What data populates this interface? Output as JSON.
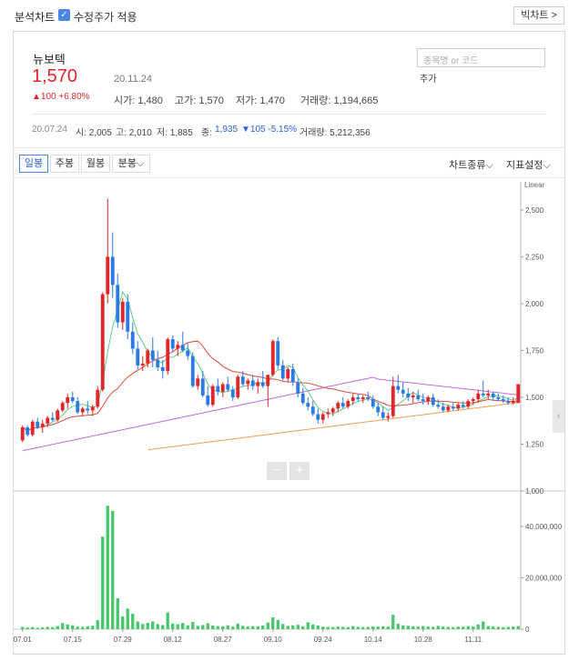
{
  "header": {
    "title": "분석차트",
    "adjust_label": "수정주가 적용",
    "big_chart_label": "빅차트 >"
  },
  "stock": {
    "name": "뉴보텍",
    "price": "1,570",
    "date": "20.11.24",
    "change": "▲100 +6.80%",
    "open": "시가: 1,480",
    "high": "고가: 1,570",
    "low": "저가: 1,470",
    "volume": "거래량: 1,194,665"
  },
  "search": {
    "placeholder": "종목명 or 코드",
    "sub": "주가"
  },
  "history": {
    "date": "20.07.24",
    "open": "시: 2,005",
    "high": "고: 2,010",
    "low": "저: 1,885",
    "close_label": "종:",
    "close": "1,935",
    "change": "▼105 -5.15%",
    "volume": "거래량: 5,212,356"
  },
  "toolbar": {
    "tabs": [
      "일봉",
      "주봉",
      "월봉",
      "분봉⌵"
    ],
    "chart_type": "차트종류⌵",
    "indicator": "지표설정⌵"
  },
  "colors": {
    "up": "#e0262b",
    "down": "#2a7be4",
    "volume": "#46c86a",
    "ma5": "#5ccf80",
    "ma20": "#e24a3c",
    "ma60": "#c26ae8",
    "ma120": "#f0a050"
  },
  "chart_data": {
    "type": "candlestick",
    "scale_label": "Linear",
    "price_ylim": [
      1000,
      2650
    ],
    "price_ticks": [
      "2,500",
      "2,250",
      "2,000",
      "1,750",
      "1,500",
      "1,250",
      "1,000"
    ],
    "volume_ticks": [
      "40,000,000",
      "20,000,000",
      "0"
    ],
    "volume_ylim": [
      0,
      52000000
    ],
    "x_ticks": [
      "07.01",
      "07.15",
      "07.29",
      "08.12",
      "08.27",
      "09.10",
      "09.24",
      "10.14",
      "10.28",
      "11.11"
    ],
    "x_tick_index": [
      0,
      10,
      20,
      30,
      40,
      50,
      60,
      70,
      80,
      90
    ],
    "candles": [
      [
        1270,
        1350,
        1260,
        1340
      ],
      [
        1340,
        1350,
        1290,
        1300
      ],
      [
        1300,
        1380,
        1290,
        1370
      ],
      [
        1370,
        1390,
        1330,
        1340
      ],
      [
        1340,
        1380,
        1310,
        1360
      ],
      [
        1360,
        1400,
        1340,
        1390
      ],
      [
        1390,
        1420,
        1370,
        1380
      ],
      [
        1380,
        1440,
        1370,
        1430
      ],
      [
        1430,
        1480,
        1420,
        1470
      ],
      [
        1470,
        1520,
        1440,
        1500
      ],
      [
        1500,
        1530,
        1470,
        1480
      ],
      [
        1480,
        1500,
        1410,
        1420
      ],
      [
        1420,
        1450,
        1400,
        1440
      ],
      [
        1440,
        1480,
        1410,
        1430
      ],
      [
        1430,
        1460,
        1400,
        1450
      ],
      [
        1450,
        1560,
        1440,
        1540
      ],
      [
        1540,
        2060,
        1530,
        2050
      ],
      [
        2050,
        2560,
        2000,
        2250
      ],
      [
        2250,
        2380,
        2030,
        2100
      ],
      [
        2100,
        2160,
        1870,
        1900
      ],
      [
        1900,
        2030,
        1860,
        2010
      ],
      [
        2010,
        2050,
        1810,
        1850
      ],
      [
        1850,
        1900,
        1730,
        1760
      ],
      [
        1760,
        1800,
        1650,
        1670
      ],
      [
        1670,
        1720,
        1640,
        1680
      ],
      [
        1680,
        1760,
        1660,
        1750
      ],
      [
        1750,
        1820,
        1660,
        1700
      ],
      [
        1700,
        1750,
        1640,
        1660
      ],
      [
        1660,
        1700,
        1600,
        1640
      ],
      [
        1640,
        1820,
        1620,
        1810
      ],
      [
        1810,
        1830,
        1740,
        1760
      ],
      [
        1760,
        1800,
        1720,
        1780
      ],
      [
        1780,
        1850,
        1740,
        1750
      ],
      [
        1750,
        1790,
        1700,
        1720
      ],
      [
        1720,
        1740,
        1550,
        1560
      ],
      [
        1560,
        1620,
        1540,
        1600
      ],
      [
        1600,
        1640,
        1500,
        1510
      ],
      [
        1510,
        1560,
        1450,
        1460
      ],
      [
        1460,
        1570,
        1450,
        1560
      ],
      [
        1560,
        1600,
        1510,
        1530
      ],
      [
        1530,
        1580,
        1500,
        1570
      ],
      [
        1570,
        1610,
        1530,
        1540
      ],
      [
        1540,
        1560,
        1480,
        1500
      ],
      [
        1500,
        1620,
        1490,
        1610
      ],
      [
        1610,
        1640,
        1560,
        1570
      ],
      [
        1570,
        1600,
        1540,
        1590
      ],
      [
        1590,
        1620,
        1540,
        1560
      ],
      [
        1560,
        1600,
        1520,
        1580
      ],
      [
        1580,
        1640,
        1550,
        1560
      ],
      [
        1560,
        1620,
        1450,
        1620
      ],
      [
        1620,
        1810,
        1610,
        1800
      ],
      [
        1800,
        1820,
        1650,
        1670
      ],
      [
        1670,
        1700,
        1590,
        1600
      ],
      [
        1600,
        1660,
        1580,
        1650
      ],
      [
        1650,
        1680,
        1560,
        1580
      ],
      [
        1580,
        1600,
        1500,
        1520
      ],
      [
        1520,
        1550,
        1460,
        1470
      ],
      [
        1470,
        1500,
        1430,
        1450
      ],
      [
        1450,
        1480,
        1400,
        1410
      ],
      [
        1410,
        1440,
        1360,
        1380
      ],
      [
        1380,
        1420,
        1360,
        1410
      ],
      [
        1410,
        1440,
        1390,
        1420
      ],
      [
        1420,
        1450,
        1400,
        1440
      ],
      [
        1440,
        1480,
        1420,
        1470
      ],
      [
        1470,
        1500,
        1440,
        1450
      ],
      [
        1450,
        1490,
        1440,
        1480
      ],
      [
        1480,
        1520,
        1460,
        1500
      ],
      [
        1500,
        1520,
        1480,
        1490
      ],
      [
        1490,
        1510,
        1470,
        1500
      ],
      [
        1500,
        1530,
        1480,
        1490
      ],
      [
        1490,
        1510,
        1440,
        1450
      ],
      [
        1450,
        1470,
        1400,
        1420
      ],
      [
        1420,
        1450,
        1380,
        1390
      ],
      [
        1390,
        1420,
        1370,
        1400
      ],
      [
        1400,
        1610,
        1390,
        1560
      ],
      [
        1560,
        1620,
        1520,
        1540
      ],
      [
        1540,
        1580,
        1500,
        1520
      ],
      [
        1520,
        1550,
        1480,
        1500
      ],
      [
        1500,
        1530,
        1470,
        1510
      ],
      [
        1510,
        1540,
        1480,
        1490
      ],
      [
        1490,
        1520,
        1460,
        1480
      ],
      [
        1480,
        1510,
        1460,
        1500
      ],
      [
        1500,
        1520,
        1450,
        1460
      ],
      [
        1460,
        1490,
        1440,
        1450
      ],
      [
        1450,
        1470,
        1420,
        1430
      ],
      [
        1430,
        1460,
        1420,
        1450
      ],
      [
        1450,
        1470,
        1430,
        1440
      ],
      [
        1440,
        1470,
        1430,
        1460
      ],
      [
        1460,
        1480,
        1440,
        1450
      ],
      [
        1450,
        1490,
        1440,
        1480
      ],
      [
        1480,
        1500,
        1460,
        1490
      ],
      [
        1490,
        1540,
        1470,
        1520
      ],
      [
        1520,
        1590,
        1500,
        1510
      ],
      [
        1510,
        1540,
        1490,
        1520
      ],
      [
        1520,
        1530,
        1480,
        1500
      ],
      [
        1500,
        1520,
        1480,
        1490
      ],
      [
        1490,
        1510,
        1470,
        1480
      ],
      [
        1480,
        1500,
        1460,
        1470
      ],
      [
        1470,
        1500,
        1460,
        1480
      ],
      [
        1470,
        1570,
        1470,
        1570
      ]
    ],
    "volume_m": [
      0.9,
      0.6,
      0.8,
      0.5,
      0.7,
      0.9,
      0.8,
      1.2,
      2.4,
      1.8,
      1.5,
      1.0,
      0.9,
      1.1,
      1.3,
      3.5,
      36,
      48,
      46,
      12,
      5,
      8,
      6,
      3,
      2,
      2.5,
      3,
      2,
      1.6,
      6.5,
      2.2,
      1.9,
      2.4,
      1.5,
      2.8,
      1.3,
      1.6,
      2.3,
      1.4,
      1.2,
      1.1,
      1.5,
      1.0,
      2.2,
      1.3,
      1.0,
      1.2,
      1.1,
      1.4,
      2.6,
      4.6,
      3.6,
      2.0,
      1.3,
      1.5,
      1.7,
      1.1,
      2.7,
      1.8,
      1.4,
      1.0,
      0.9,
      0.8,
      1.0,
      0.9,
      0.8,
      1.2,
      0.9,
      0.8,
      0.9,
      1.1,
      1.0,
      1.1,
      1.0,
      5.6,
      2.1,
      1.5,
      1.3,
      1.1,
      1.0,
      1.2,
      1.0,
      0.9,
      1.3,
      1.0,
      0.9,
      0.8,
      1.0,
      0.9,
      1.2,
      1.0,
      1.8,
      3.0,
      1.2,
      1.0,
      0.9,
      0.8,
      0.9,
      1.0,
      1.2
    ]
  }
}
